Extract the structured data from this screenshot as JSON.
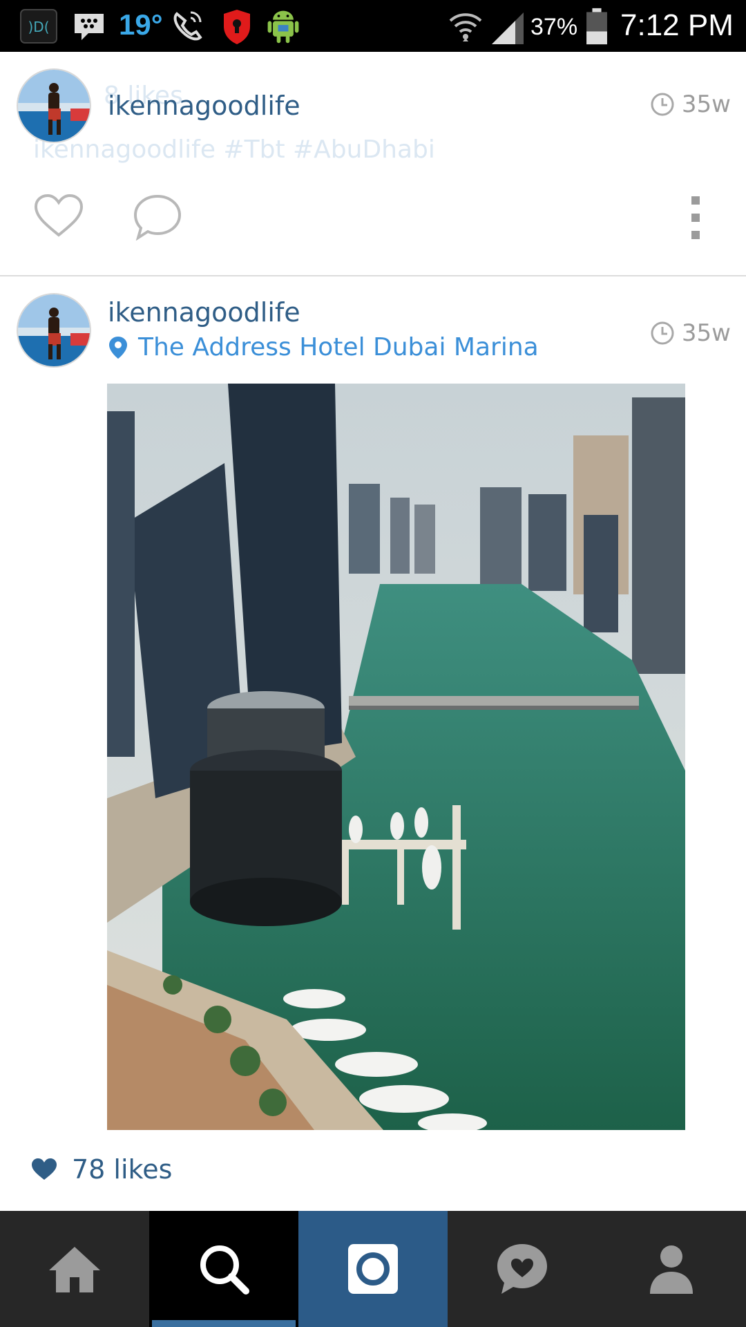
{
  "status_bar": {
    "temperature": "19°",
    "battery_percent": "37%",
    "time": "7:12 PM",
    "icons": [
      "signal-app-icon",
      "bbm-icon",
      "phone-icon",
      "shield-icon",
      "android-icon",
      "wifi-icon",
      "cell-signal-icon",
      "battery-icon"
    ]
  },
  "posts": [
    {
      "username": "ikennagoodlife",
      "time": "35w",
      "ghost_likes": "8 likes",
      "ghost_caption": "ikennagoodlife #Tbt #AbuDhabi"
    },
    {
      "username": "ikennagoodlife",
      "time": "35w",
      "location": "The Address Hotel Dubai Marina",
      "likes": "78 likes"
    }
  ],
  "bottom_nav": {
    "items": [
      "home-icon",
      "search-icon",
      "camera-icon",
      "activity-icon",
      "profile-icon"
    ],
    "active": "search-icon"
  },
  "colors": {
    "accent": "#2f5d86",
    "location": "#3b8fd8",
    "nav_bg": "#272727",
    "camera_tab": "#2c5b88"
  }
}
